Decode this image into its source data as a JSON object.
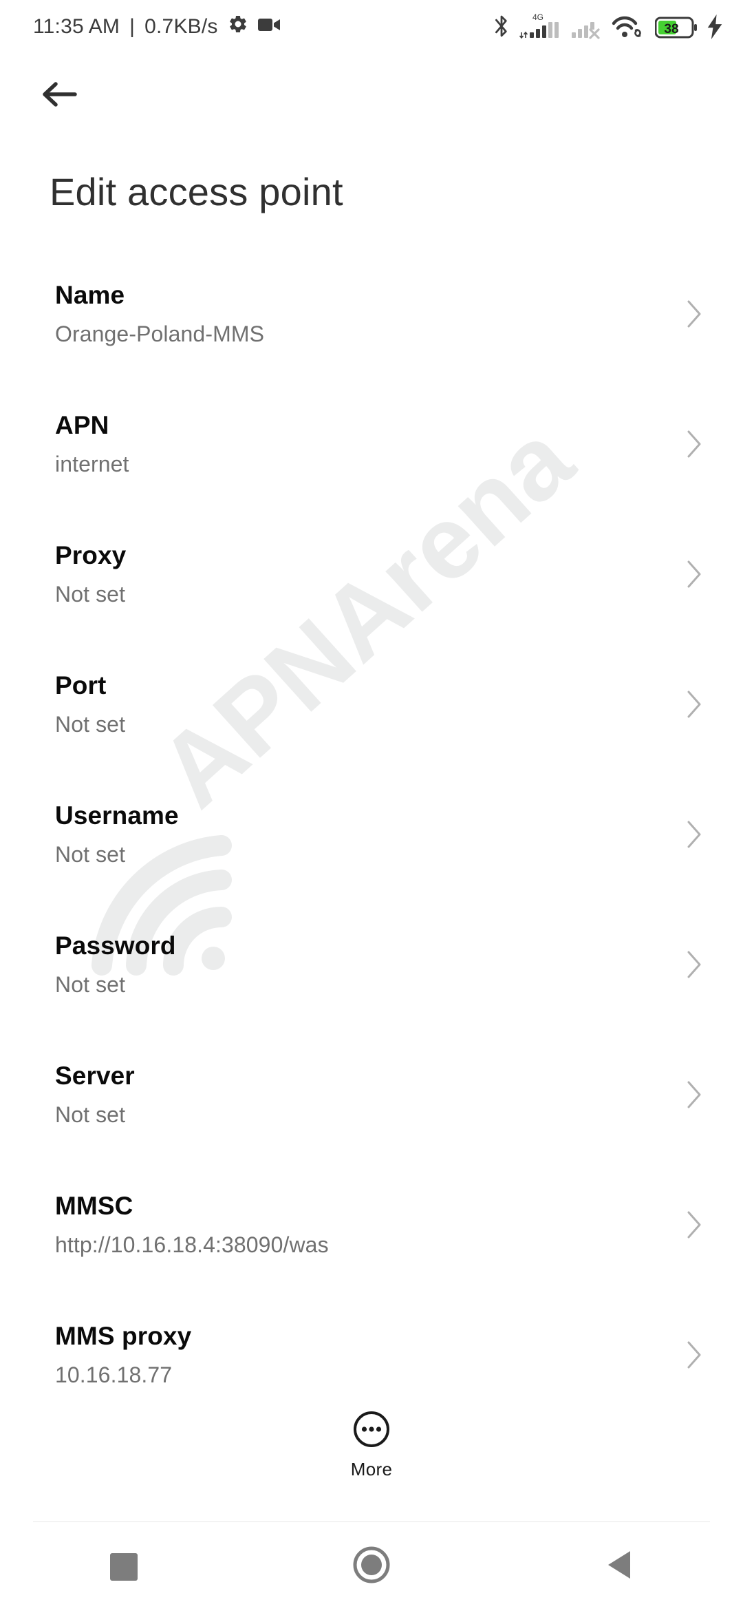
{
  "statusbar": {
    "time": "11:35 AM",
    "separator": "|",
    "net_speed": "0.7KB/s",
    "left_icons": [
      "gear-icon",
      "video-camera-icon"
    ],
    "right_icons": [
      "bluetooth-icon",
      "signal-4g-icon",
      "signal-sim2-no-service-icon",
      "wifi-icon",
      "battery-icon",
      "charging-bolt-icon"
    ],
    "network_type": "4G",
    "battery_percent": "38"
  },
  "appbar": {
    "back_icon": "arrow-left-icon",
    "title": "Edit access point"
  },
  "watermark": {
    "text": "APNArena",
    "color": "#eceded"
  },
  "list": {
    "items": [
      {
        "label": "Name",
        "value": "Orange-Poland-MMS"
      },
      {
        "label": "APN",
        "value": "internet"
      },
      {
        "label": "Proxy",
        "value": "Not set"
      },
      {
        "label": "Port",
        "value": "Not set"
      },
      {
        "label": "Username",
        "value": "Not set"
      },
      {
        "label": "Password",
        "value": "Not set"
      },
      {
        "label": "Server",
        "value": "Not set"
      },
      {
        "label": "MMSC",
        "value": "http://10.16.18.4:38090/was"
      },
      {
        "label": "MMS proxy",
        "value": "10.16.18.77"
      }
    ],
    "chevron_icon": "chevron-right-icon"
  },
  "more_button": {
    "icon": "more-dots-circle-icon",
    "label": "More"
  },
  "navbar": {
    "recents_label": "recents-button",
    "home_label": "home-button",
    "back_label": "back-button",
    "icons": [
      "square-icon",
      "circle-icon",
      "triangle-left-icon"
    ]
  },
  "colors": {
    "background": "#ffffff",
    "title_text": "#303030",
    "primary_text": "#0a0a0a",
    "secondary_text": "#707070",
    "chevron": "#b0b0b0",
    "divider": "#e6e6e6",
    "nav_icon": "#7d7d7d",
    "battery_green": "#45d131",
    "status_icon": "#3c3c3c"
  }
}
